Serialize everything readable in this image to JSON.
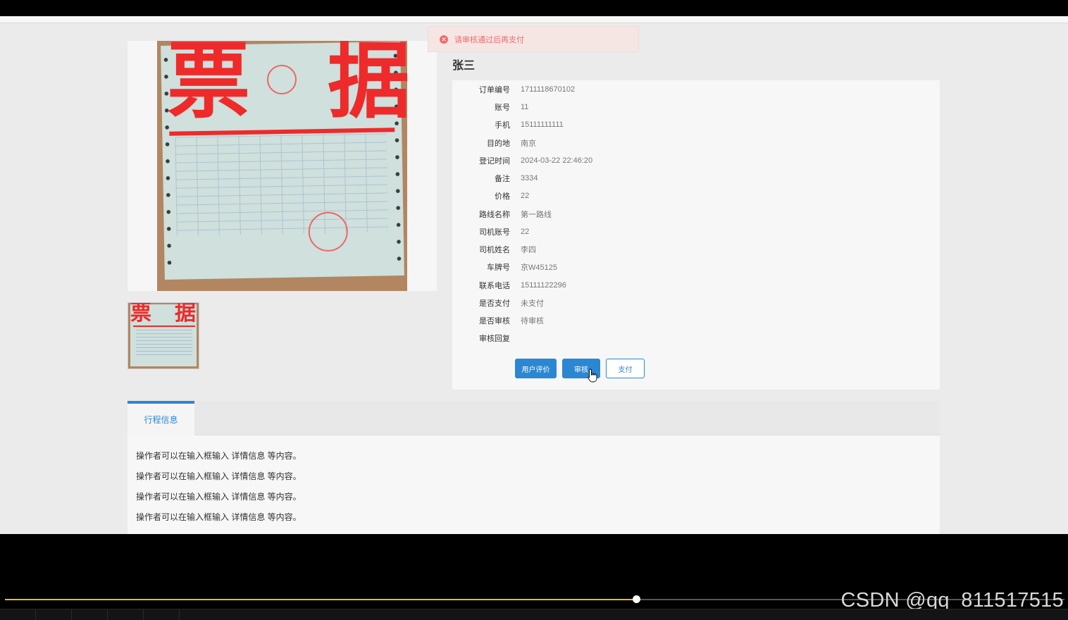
{
  "toast": {
    "message": "请审核通过后再支付",
    "icon": "error-circle-icon",
    "color": "#f06c6c"
  },
  "receipt_image": {
    "big_chars": [
      "票",
      "据"
    ]
  },
  "order": {
    "name": "张三",
    "fields": [
      {
        "label": "订单编号",
        "value": "1711118670102"
      },
      {
        "label": "账号",
        "value": "11"
      },
      {
        "label": "手机",
        "value": "15111111111"
      },
      {
        "label": "目的地",
        "value": "南京"
      },
      {
        "label": "登记时间",
        "value": "2024-03-22 22:46:20"
      },
      {
        "label": "备注",
        "value": "3334"
      },
      {
        "label": "价格",
        "value": "22"
      },
      {
        "label": "路线名称",
        "value": "第一路线"
      },
      {
        "label": "司机账号",
        "value": "22"
      },
      {
        "label": "司机姓名",
        "value": "李四"
      },
      {
        "label": "车牌号",
        "value": "京W45125"
      },
      {
        "label": "联系电话",
        "value": "15111122296"
      },
      {
        "label": "是否支付",
        "value": "未支付"
      },
      {
        "label": "是否审核",
        "value": "待审核"
      },
      {
        "label": "审核回复",
        "value": ""
      }
    ]
  },
  "actions": {
    "review_label": "用户评价",
    "audit_label": "审核",
    "pay_label": "支付"
  },
  "tabs": {
    "active_label": "行程信息"
  },
  "tab_content": {
    "lines": [
      "操作者可以在输入框输入  详情信息  等内容。",
      "操作者可以在输入框输入  详情信息  等内容。",
      "操作者可以在输入框输入  详情信息  等内容。",
      "操作者可以在输入框输入  详情信息  等内容。"
    ]
  },
  "player": {
    "progress": 0.596,
    "accent": "#e6c200"
  },
  "watermark": "CSDN @qq_811517515"
}
